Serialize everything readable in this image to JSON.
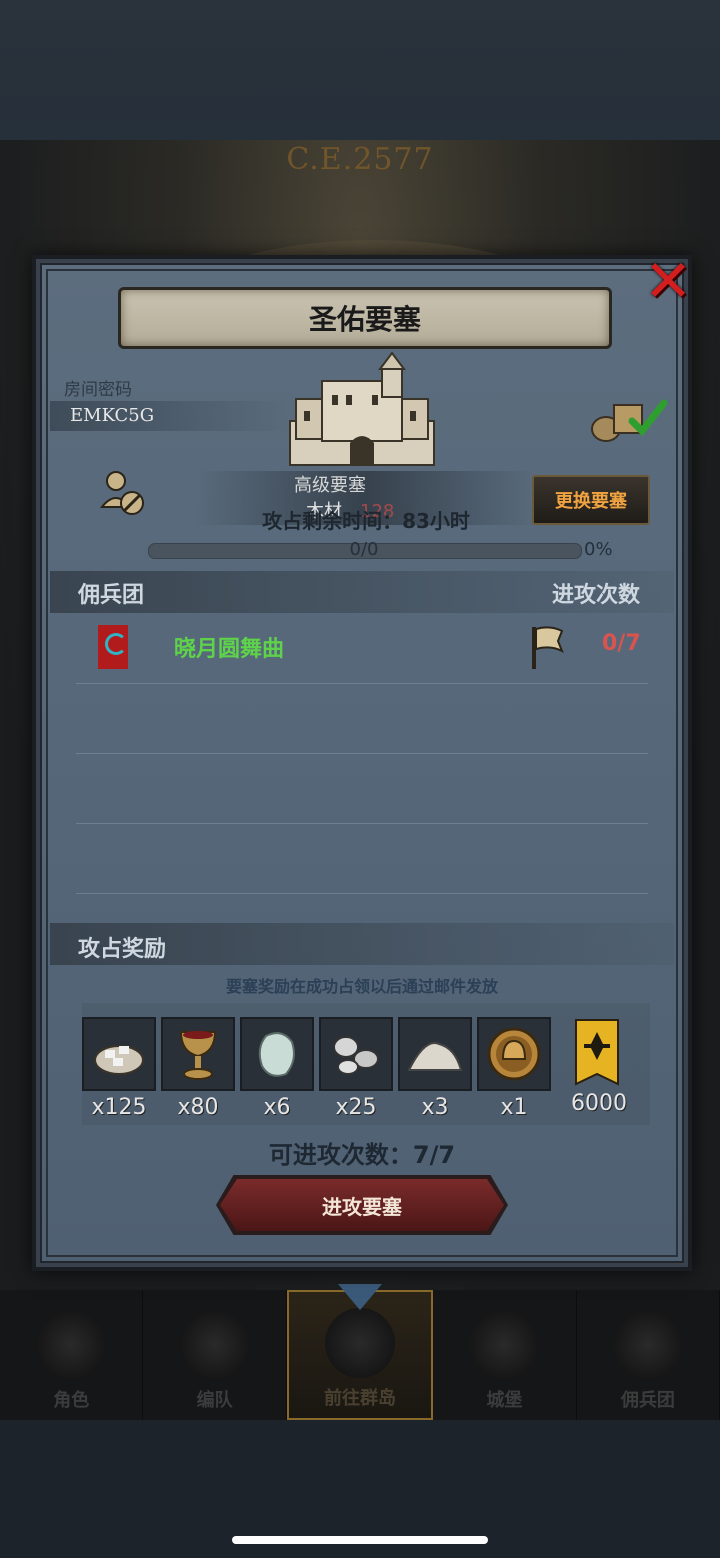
{
  "background": {
    "era_text": "C.E.2577"
  },
  "modal": {
    "title": "圣佑要塞",
    "close_icon": "close-x-icon",
    "room_code_label": "房间密码",
    "room_code": "EMKC5G",
    "fortress": {
      "grade": "高级要塞",
      "resource_label": "木材",
      "resource_value": "128",
      "remaining_time": "攻占剩余时间：83小时",
      "change_button": "更换要塞"
    },
    "progress": {
      "label": "0/0",
      "percent_label": "0%",
      "fraction": 0
    },
    "mercenary_section": {
      "title": "佣兵团",
      "attack_count_header": "进攻次数",
      "rows": [
        {
          "name": "晓月圆舞曲",
          "attacks": "0/7"
        }
      ]
    },
    "rewards_section": {
      "title": "攻占奖励",
      "note": "要塞奖励在成功占领以后通过邮件发放",
      "items": [
        {
          "icon": "silver-ore-sack-icon",
          "qty": "x125"
        },
        {
          "icon": "goblet-icon",
          "qty": "x80"
        },
        {
          "icon": "moonstone-icon",
          "qty": "x6"
        },
        {
          "icon": "silver-nuggets-icon",
          "qty": "x25"
        },
        {
          "icon": "powder-pile-icon",
          "qty": "x3"
        },
        {
          "icon": "helmet-medal-icon",
          "qty": "x1"
        },
        {
          "icon": "guild-banner-icon",
          "qty": "6000"
        }
      ]
    },
    "attempts_text": "可进攻次数：7/7",
    "attack_button": "进攻要塞"
  },
  "bottom_nav": {
    "items": [
      {
        "label": "角色",
        "icon": "knight-icon"
      },
      {
        "label": "编队",
        "icon": "formation-icon"
      },
      {
        "label": "前往群岛",
        "icon": "globe-icon",
        "active": true
      },
      {
        "label": "城堡",
        "icon": "castle-icon"
      },
      {
        "label": "佣兵团",
        "icon": "mercenary-icon"
      }
    ]
  },
  "colors": {
    "accent_green": "#5ed24a",
    "attack_red": "#d9534f",
    "change_button_text": "#f0a340",
    "close_red": "#d21e1e"
  }
}
